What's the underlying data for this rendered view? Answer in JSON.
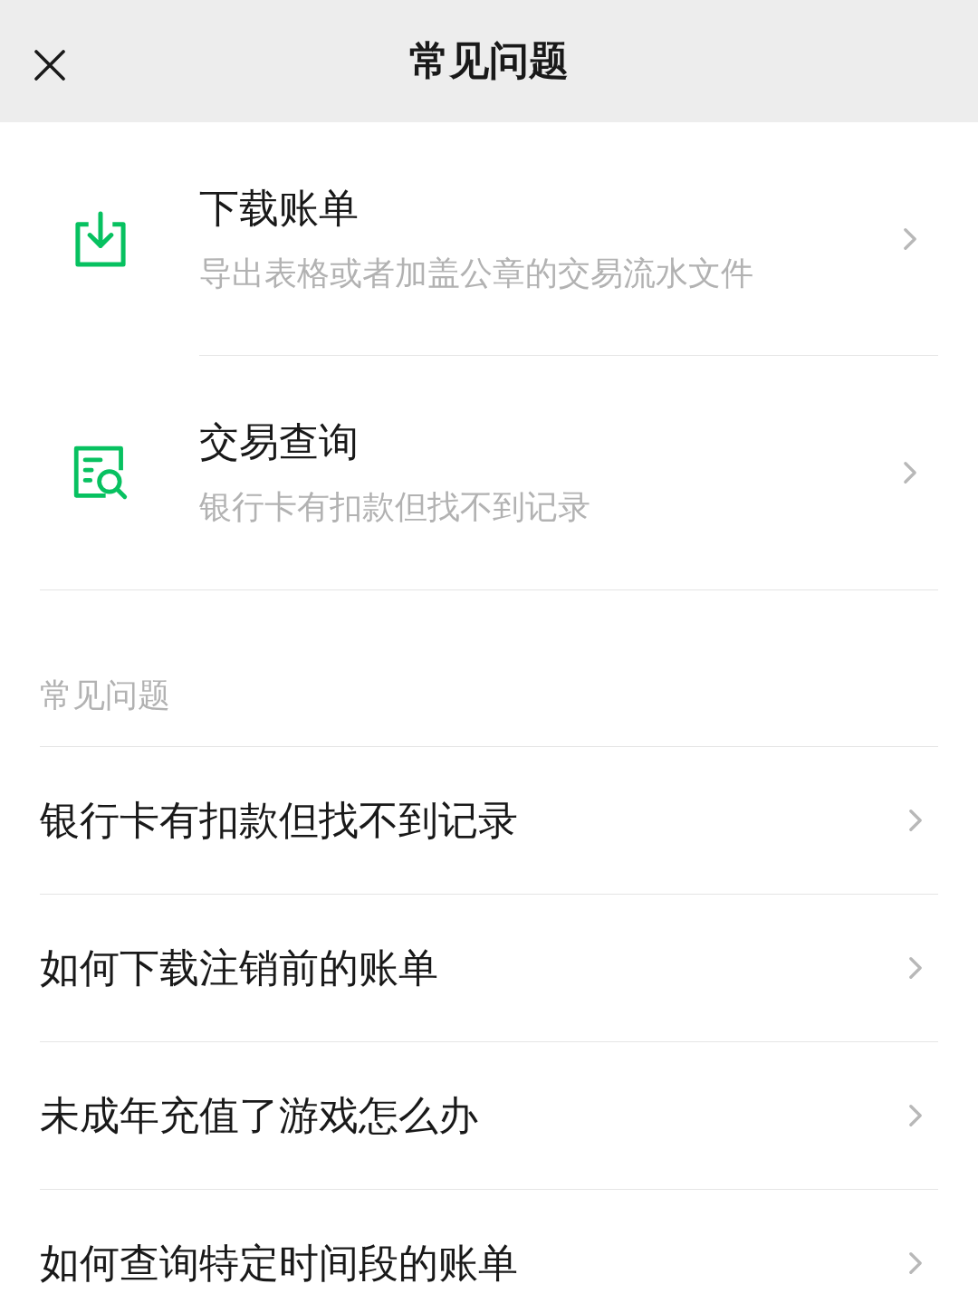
{
  "header": {
    "title": "常见问题"
  },
  "entries": [
    {
      "kind": "download",
      "title": "下载账单",
      "subtitle": "导出表格或者加盖公章的交易流水文件"
    },
    {
      "kind": "search",
      "title": "交易查询",
      "subtitle": "银行卡有扣款但找不到记录"
    }
  ],
  "faq": {
    "heading": "常见问题",
    "items": [
      "银行卡有扣款但找不到记录",
      "如何下载注销前的账单",
      "未成年充值了游戏怎么办",
      "如何查询特定时间段的账单"
    ]
  }
}
